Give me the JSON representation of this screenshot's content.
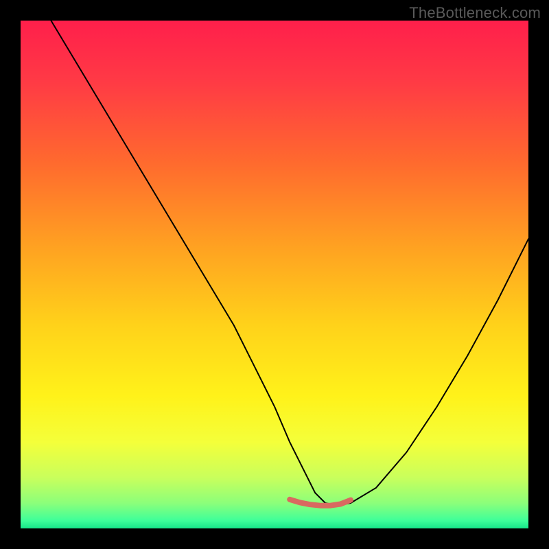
{
  "watermark": "TheBottleneck.com",
  "gradient_stops": [
    {
      "offset": 0.0,
      "color": "#ff1f4b"
    },
    {
      "offset": 0.12,
      "color": "#ff3a45"
    },
    {
      "offset": 0.28,
      "color": "#ff6a2e"
    },
    {
      "offset": 0.45,
      "color": "#ffa321"
    },
    {
      "offset": 0.6,
      "color": "#ffd21a"
    },
    {
      "offset": 0.74,
      "color": "#fff21a"
    },
    {
      "offset": 0.83,
      "color": "#f4ff3a"
    },
    {
      "offset": 0.9,
      "color": "#c9ff5c"
    },
    {
      "offset": 0.95,
      "color": "#8cff7a"
    },
    {
      "offset": 0.985,
      "color": "#3dff9a"
    },
    {
      "offset": 1.0,
      "color": "#16e58a"
    }
  ],
  "curve_color": "#000000",
  "marker_color": "#d96a60",
  "chart_data": {
    "type": "line",
    "title": "",
    "xlabel": "",
    "ylabel": "",
    "xlim": [
      0,
      100
    ],
    "ylim": [
      0,
      100
    ],
    "series": [
      {
        "name": "bottleneck-curve",
        "x": [
          0,
          6,
          12,
          18,
          24,
          30,
          36,
          42,
          46,
          50,
          53,
          56,
          58,
          60,
          62.5,
          65,
          70,
          76,
          82,
          88,
          94,
          100
        ],
        "y": [
          110,
          100,
          90,
          80,
          70,
          60,
          50,
          40,
          32,
          24,
          17,
          11,
          7,
          5,
          4.5,
          5,
          8,
          15,
          24,
          34,
          45,
          57
        ]
      },
      {
        "name": "optimal-band",
        "x": [
          53,
          55,
          57,
          59,
          61,
          63,
          65
        ],
        "y": [
          5.7,
          5.1,
          4.7,
          4.5,
          4.5,
          4.8,
          5.6
        ]
      }
    ],
    "annotations": []
  }
}
